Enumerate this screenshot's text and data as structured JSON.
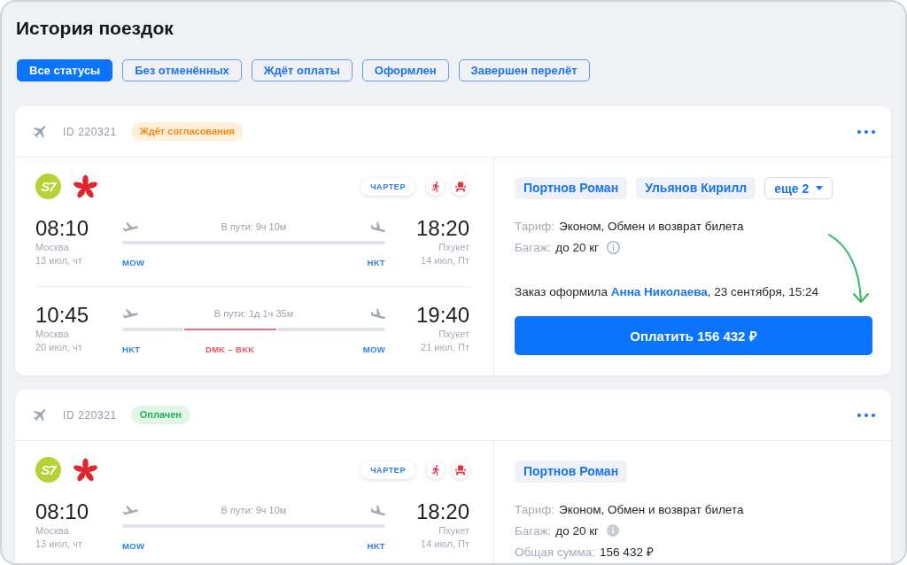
{
  "page": {
    "title": "История поездок"
  },
  "filters": [
    {
      "label": "Все статусы",
      "selected": true
    },
    {
      "label": "Без отменённых",
      "selected": false
    },
    {
      "label": "Ждёт оплаты",
      "selected": false
    },
    {
      "label": "Оформлен",
      "selected": false
    },
    {
      "label": "Завершен перелёт",
      "selected": false
    }
  ],
  "trips": [
    {
      "id": "ID 220321",
      "status": {
        "label": "Ждёт согласования",
        "kind": "pending"
      },
      "airlines": [
        {
          "kind": "text-logo",
          "text": "S7"
        },
        {
          "kind": "flower-logo"
        }
      ],
      "charter_label": "ЧАРТЕР",
      "segments": [
        {
          "departure": {
            "time": "08:10",
            "city": "Москва",
            "date": "13 июл, чт",
            "code": "MOW"
          },
          "duration": "В пути: 9ч 10м",
          "arrival": {
            "time": "18:20",
            "city": "Пхукет",
            "date": "14 июл, Пт",
            "code": "HKT"
          }
        },
        {
          "departure": {
            "time": "10:45",
            "city": "Москва",
            "date": "20 июл, чт",
            "code": "HKT"
          },
          "duration": "В пути: 1д 1ч 35м",
          "layover": {
            "code": "DMK – BKK"
          },
          "arrival": {
            "time": "19:40",
            "city": "Пхукет",
            "date": "21 июл, Пт",
            "code": "MOW"
          }
        }
      ],
      "passengers": [
        "Портнов Роман",
        "Ульянов Кирилл"
      ],
      "more_passengers": "еще 2",
      "details": [
        {
          "label": "Тариф:",
          "value": "Эконом, Обмен и возврат билета"
        },
        {
          "label": "Багаж:",
          "value": "до 20 кг",
          "info_icon": {
            "filled": false
          }
        }
      ],
      "order_note": {
        "before": "Заказ оформила",
        "author": "Анна Николаева",
        "after": ", 23 сентября, 15:24"
      },
      "pay_button": "Оплатить 156 432 ₽",
      "pointer_arrow": true
    },
    {
      "id": "ID 220321",
      "status": {
        "label": "Оплачен",
        "kind": "paid"
      },
      "airlines": [
        {
          "kind": "text-logo",
          "text": "S7"
        },
        {
          "kind": "flower-logo"
        }
      ],
      "charter_label": "ЧАРТЕР",
      "segments": [
        {
          "departure": {
            "time": "08:10",
            "city": "Москва",
            "date": "13 июл, чт",
            "code": "MOW"
          },
          "duration": "В пути: 9ч 10м",
          "arrival": {
            "time": "18:20",
            "city": "Пхукет",
            "date": "14 июл, Пт",
            "code": "HKT"
          }
        }
      ],
      "passengers": [
        "Портнов Роман"
      ],
      "details": [
        {
          "label": "Тариф:",
          "value": "Эконом, Обмен и возврат билета"
        },
        {
          "label": "Багаж:",
          "value": "до 20 кг",
          "info_icon": {
            "filled": true
          }
        },
        {
          "label": "Общая сумма:",
          "value": "156 432 ₽"
        }
      ]
    }
  ]
}
